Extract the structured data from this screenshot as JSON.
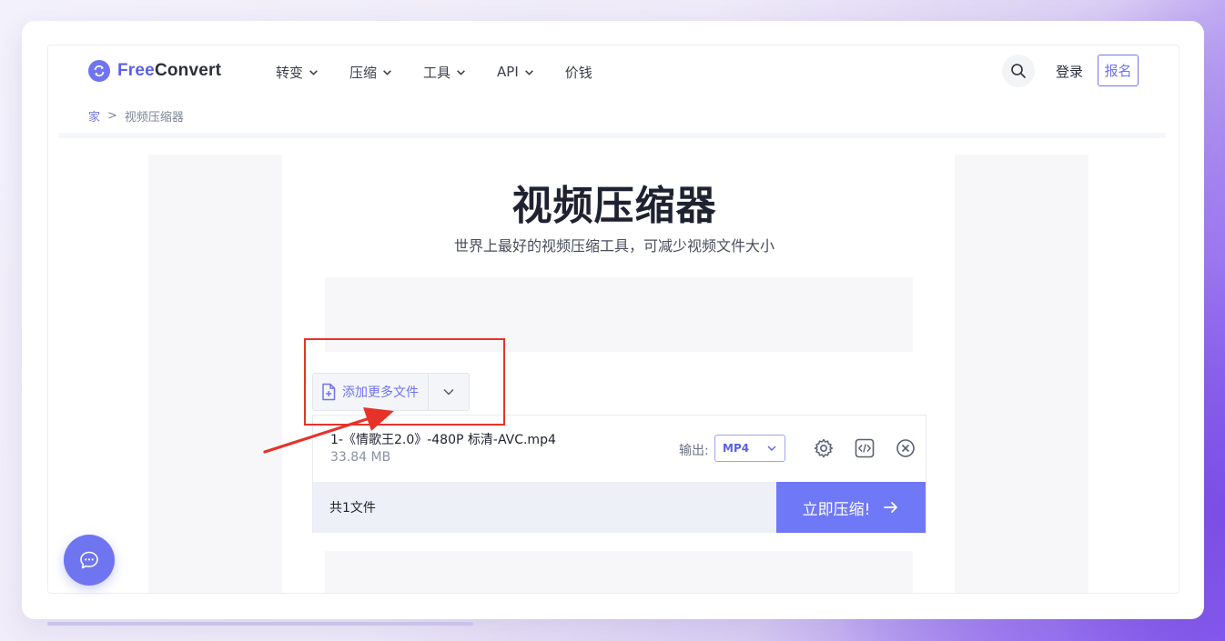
{
  "header": {
    "logo": "FreeConvert",
    "logo_part1": "Free",
    "logo_part2": "Convert",
    "nav": [
      {
        "label": "转变",
        "has_dropdown": true
      },
      {
        "label": "压缩",
        "has_dropdown": true
      },
      {
        "label": "工具",
        "has_dropdown": true
      },
      {
        "label": "API",
        "has_dropdown": true
      },
      {
        "label": "价钱",
        "has_dropdown": false
      }
    ],
    "login_label": "登录",
    "signup_label": "报名"
  },
  "breadcrumb": {
    "home": "家",
    "separator": ">",
    "current": "视频压缩器"
  },
  "main": {
    "title": "视频压缩器",
    "subtitle": "世界上最好的视频压缩工具，可减少视频文件大小",
    "add_files_label": "添加更多文件"
  },
  "file": {
    "name": "1-《情歌王2.0》-480P 标清-AVC.mp4",
    "size": "33.84 MB",
    "output_label": "输出:",
    "format": "MP4"
  },
  "footer": {
    "file_count": "共1文件",
    "convert_label": "立即压缩!"
  },
  "colors": {
    "accent": "#6f74f0",
    "button": "#6f78f6",
    "highlight": "#e63329"
  }
}
